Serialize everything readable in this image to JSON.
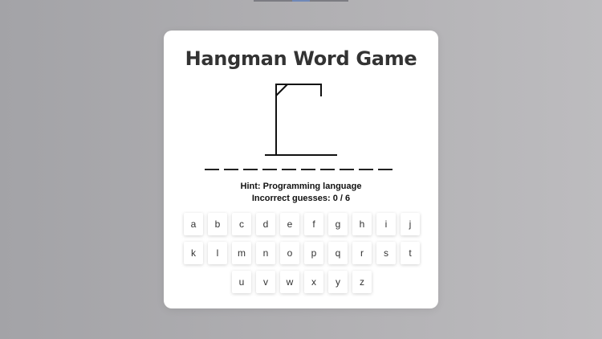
{
  "game": {
    "title": "Hangman Word Game",
    "word_length": 10,
    "hint_label": "Hint:",
    "hint_text": "Programming language",
    "incorrect_label": "Incorrect guesses:",
    "incorrect_count": 0,
    "max_incorrect": 6,
    "hint_line": "Hint: Programming language",
    "incorrect_line": "Incorrect guesses: 0 / 6"
  },
  "keyboard": {
    "letters": [
      "a",
      "b",
      "c",
      "d",
      "e",
      "f",
      "g",
      "h",
      "i",
      "j",
      "k",
      "l",
      "m",
      "n",
      "o",
      "p",
      "q",
      "r",
      "s",
      "t",
      "u",
      "v",
      "w",
      "x",
      "y",
      "z"
    ]
  },
  "colors": {
    "background_left": "#a3a3a7",
    "background_right": "#bdbcbf",
    "card": "#ffffff",
    "title": "#333333",
    "stroke": "#111111"
  }
}
